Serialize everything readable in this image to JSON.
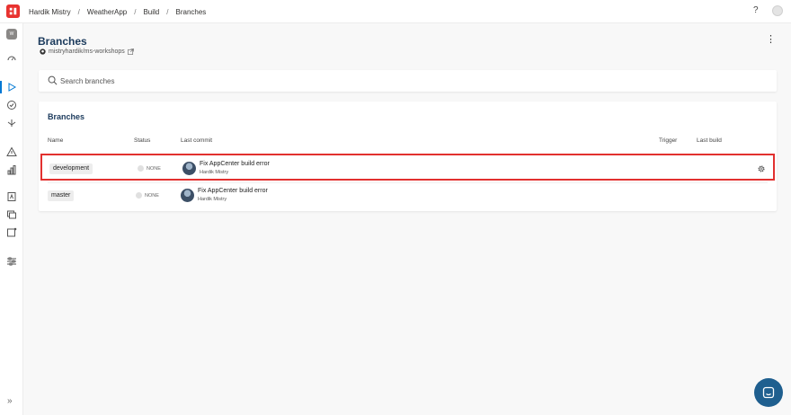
{
  "breadcrumb": {
    "owner": "Hardik Mistry",
    "app": "WeatherApp",
    "section": "Build",
    "page": "Branches",
    "separator": "/"
  },
  "header": {
    "help_label": "?"
  },
  "sidebar": {
    "app_initial": "W",
    "expand_label": "»"
  },
  "page": {
    "title": "Branches",
    "repo": "mistryhardik/ms-workshops"
  },
  "search": {
    "placeholder": "Search branches",
    "value": ""
  },
  "branches_card": {
    "title": "Branches",
    "columns": [
      "Name",
      "Status",
      "Last commit",
      "Trigger",
      "Last build"
    ],
    "rows": [
      {
        "name": "development",
        "status": "NONE",
        "commit_message": "Fix AppCenter build error",
        "commit_author": "Hardik Mistry",
        "trigger": "",
        "last_build": "",
        "highlighted": true
      },
      {
        "name": "master",
        "status": "NONE",
        "commit_message": "Fix AppCenter build error",
        "commit_author": "Hardik Mistry",
        "trigger": "",
        "last_build": "",
        "highlighted": false
      }
    ]
  },
  "colors": {
    "accent": "#0078d4",
    "highlight_border": "#e2302f",
    "title": "#1b3a5c",
    "chat_button": "#1f5f8f"
  }
}
